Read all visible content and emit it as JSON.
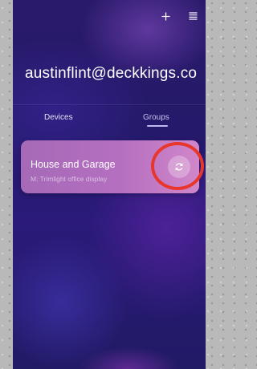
{
  "header": {
    "add_icon": "plus-icon",
    "menu_icon": "menu-lines-icon"
  },
  "account": {
    "email": "austinflint@deckkings.co"
  },
  "tabs": [
    {
      "label": "Devices",
      "active": false
    },
    {
      "label": "Groups",
      "active": true
    }
  ],
  "groups": [
    {
      "name": "House and Garage",
      "subtitle": "M: Trimlight office display",
      "action_icon": "sync-icon"
    }
  ],
  "colors": {
    "highlight": "#e8362d",
    "card_start": "#a56ab7",
    "card_end": "#d086c9"
  }
}
